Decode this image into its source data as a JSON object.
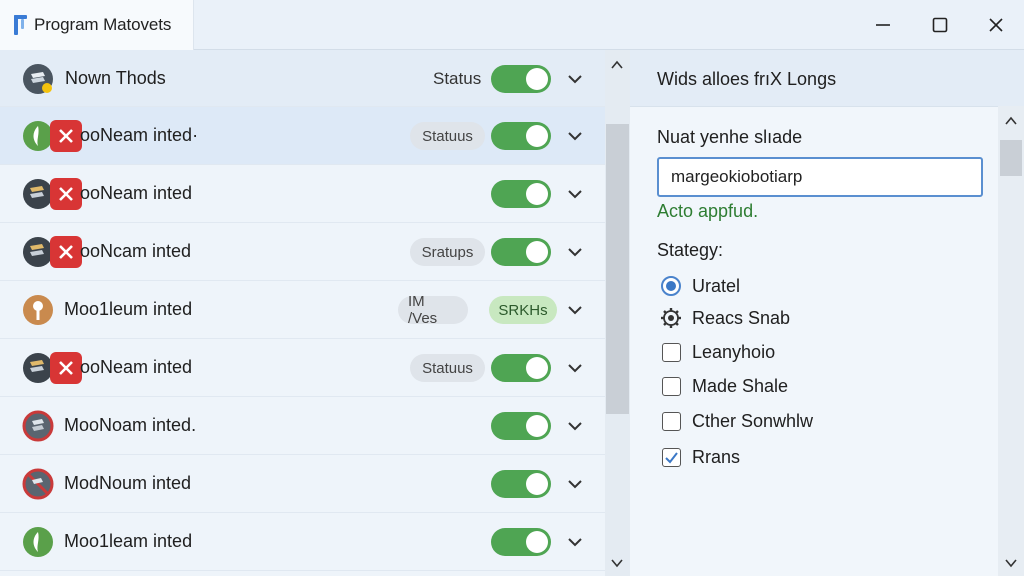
{
  "window": {
    "title": "Program Matovets",
    "controls": [
      "minimize-icon",
      "maximize-icon",
      "close-icon"
    ]
  },
  "list": {
    "header": {
      "name": "Nown Thods",
      "status_label": "Status",
      "toggle_on": true
    },
    "rows": [
      {
        "name": "ooNeam inted·",
        "pill": "Statuus",
        "pill_style": "gray",
        "toggle_on": true,
        "avatar": "green-leaf-icon",
        "error": true
      },
      {
        "name": "ooNeam inted",
        "pill": "",
        "pill_style": "",
        "toggle_on": true,
        "avatar": "dark-stack-icon",
        "error": true
      },
      {
        "name": "ooNcam inted",
        "pill": "Sratups",
        "pill_style": "gray",
        "toggle_on": true,
        "avatar": "dark-stack-icon",
        "error": true
      },
      {
        "name": "Moo1leum inted",
        "pill": "IM /Ves",
        "pill_style": "gray",
        "pill2": "SRKHs",
        "toggle_on": false,
        "avatar": "orange-pin-icon",
        "error": false
      },
      {
        "name": "ooNeam inted",
        "pill": "Statuus",
        "pill_style": "gray",
        "toggle_on": true,
        "avatar": "dark-stack-icon",
        "error": true
      },
      {
        "name": "MooNoam inted.",
        "pill": "",
        "pill_style": "",
        "toggle_on": true,
        "avatar": "red-ring-icon",
        "error": false
      },
      {
        "name": "ModNoum inted",
        "pill": "",
        "pill_style": "",
        "toggle_on": true,
        "avatar": "red-ring-blocked-icon",
        "error": false
      },
      {
        "name": "Moo1leam inted",
        "pill": "",
        "pill_style": "",
        "toggle_on": true,
        "avatar": "green-leaf-icon",
        "error": false
      }
    ]
  },
  "detail": {
    "header_title": "Wids alloes frıX Longs",
    "field_label": "Nuat yenhe slıade",
    "field_value": "margeokiobotiarp",
    "success_message": "Acto appfud.",
    "strategy_label": "Stategy:",
    "options": [
      {
        "label": "Uratel",
        "kind": "radio",
        "checked": true
      },
      {
        "label": "Reacs Snab",
        "kind": "gear",
        "checked": false
      },
      {
        "label": "Leanyhoio",
        "kind": "checkbox",
        "checked": false
      },
      {
        "label": "Made Shale",
        "kind": "checkbox",
        "checked": false
      },
      {
        "label": "Cther Sonwhlw",
        "kind": "checkbox",
        "checked": false
      },
      {
        "label": "Rrans",
        "kind": "checkbox",
        "checked": true
      }
    ]
  },
  "colors": {
    "toggle_on": "#4fa553",
    "error_badge": "#d83535",
    "success_text": "#2e7d32",
    "accent_blue": "#3b78c6"
  }
}
